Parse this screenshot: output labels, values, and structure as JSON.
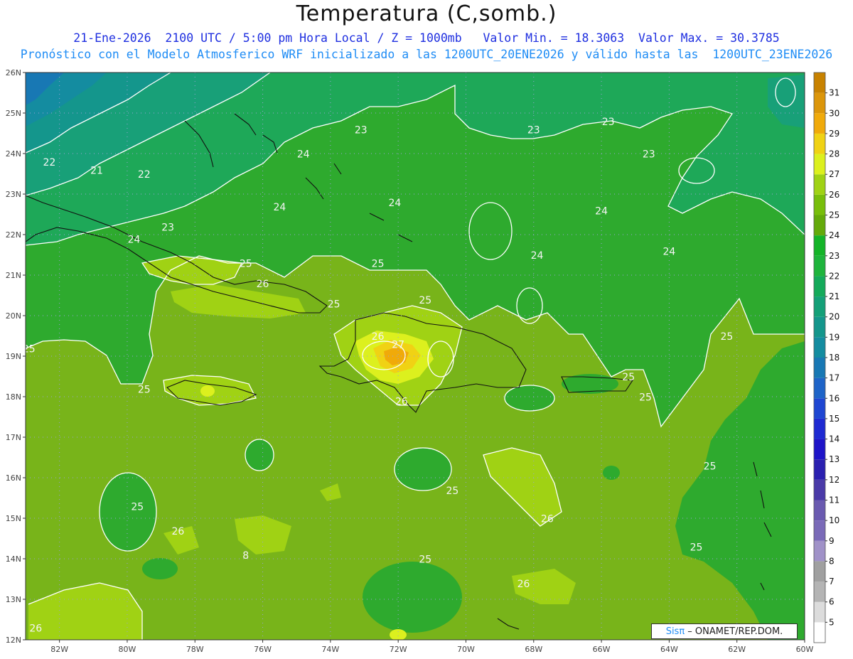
{
  "title": "Temperatura (C,somb.)",
  "subtitle_line1": "21-Ene-2026  2100 UTC / 5:00 pm Hora Local / Z = 1000mb   Valor Min. = 18.3063  Valor Max. = 30.3785",
  "subtitle_line2": "Pronóstico con el Modelo Atmosferico WRF inicializado a las 1200UTC_20ENE2026 y válido hasta las  1200UTC_23ENE2026",
  "credit_brand": "Sisπ",
  "credit_text": " – ONAMET/REP.DOM.",
  "lat_labels": [
    "26N",
    "25N",
    "24N",
    "23N",
    "22N",
    "21N",
    "20N",
    "19N",
    "18N",
    "17N",
    "16N",
    "15N",
    "14N",
    "13N",
    "12N"
  ],
  "lon_labels": [
    "82W",
    "80W",
    "78W",
    "76W",
    "74W",
    "72W",
    "70W",
    "68W",
    "66W",
    "64W",
    "62W",
    "60W"
  ],
  "colorbar": {
    "levels": [
      "5",
      "6",
      "7",
      "8",
      "9",
      "10",
      "11",
      "12",
      "13",
      "14",
      "15",
      "16",
      "17",
      "18",
      "19",
      "20",
      "21",
      "22",
      "23",
      "24",
      "25",
      "26",
      "27",
      "28",
      "29",
      "30",
      "31"
    ],
    "colors": [
      "#ffffff",
      "#dcdcdc",
      "#b4b4b4",
      "#a0a0a0",
      "#a092c8",
      "#7a6ab8",
      "#6a5ab0",
      "#4a3aa8",
      "#2a20b0",
      "#1e14c8",
      "#1e2ad2",
      "#1e46d2",
      "#1e64c8",
      "#1878b4",
      "#148ca0",
      "#14968c",
      "#14a078",
      "#14aa5a",
      "#1eb43c",
      "#14b428",
      "#64aa0a",
      "#78be0a",
      "#a0d214",
      "#dcf01e",
      "#f0d214",
      "#f0aa0a",
      "#dc960a",
      "#c88200"
    ]
  },
  "contour_labels": [
    {
      "t": "22",
      "lon": -82.3,
      "lat": 23.7
    },
    {
      "t": "21",
      "lon": -80.9,
      "lat": 23.5
    },
    {
      "t": "22",
      "lon": -79.5,
      "lat": 23.4
    },
    {
      "t": "24",
      "lon": -74.8,
      "lat": 23.9
    },
    {
      "t": "23",
      "lon": -73.1,
      "lat": 24.5
    },
    {
      "t": "24",
      "lon": -75.5,
      "lat": 22.6
    },
    {
      "t": "24",
      "lon": -72.1,
      "lat": 22.7
    },
    {
      "t": "23",
      "lon": -68.0,
      "lat": 24.5
    },
    {
      "t": "23",
      "lon": -65.8,
      "lat": 24.7
    },
    {
      "t": "23",
      "lon": -64.6,
      "lat": 23.9
    },
    {
      "t": "24",
      "lon": -66.0,
      "lat": 22.5
    },
    {
      "t": "24",
      "lon": -67.9,
      "lat": 21.4
    },
    {
      "t": "24",
      "lon": -64.0,
      "lat": 21.5
    },
    {
      "t": "23",
      "lon": -78.8,
      "lat": 22.1
    },
    {
      "t": "24",
      "lon": -79.8,
      "lat": 21.8
    },
    {
      "t": "25",
      "lon": -76.5,
      "lat": 21.2
    },
    {
      "t": "26",
      "lon": -76.0,
      "lat": 20.7
    },
    {
      "t": "25",
      "lon": -73.9,
      "lat": 20.2
    },
    {
      "t": "25",
      "lon": -72.6,
      "lat": 21.2
    },
    {
      "t": "25",
      "lon": -71.2,
      "lat": 20.3
    },
    {
      "t": "26",
      "lon": -72.6,
      "lat": 19.4
    },
    {
      "t": "27",
      "lon": -72.0,
      "lat": 19.2
    },
    {
      "t": "26",
      "lon": -71.9,
      "lat": 17.8
    },
    {
      "t": "25",
      "lon": -82.9,
      "lat": 19.1
    },
    {
      "t": "25",
      "lon": -79.5,
      "lat": 18.1
    },
    {
      "t": "25",
      "lon": -65.2,
      "lat": 18.4
    },
    {
      "t": "25",
      "lon": -64.7,
      "lat": 17.9
    },
    {
      "t": "25",
      "lon": -62.3,
      "lat": 19.4
    },
    {
      "t": "25",
      "lon": -70.4,
      "lat": 15.6
    },
    {
      "t": "26",
      "lon": -67.6,
      "lat": 14.9
    },
    {
      "t": "25",
      "lon": -62.8,
      "lat": 16.2
    },
    {
      "t": "25",
      "lon": -63.2,
      "lat": 14.2
    },
    {
      "t": "25",
      "lon": -79.7,
      "lat": 15.2
    },
    {
      "t": "26",
      "lon": -78.5,
      "lat": 14.6
    },
    {
      "t": "8",
      "lon": -76.5,
      "lat": 14.0
    },
    {
      "t": "25",
      "lon": -71.2,
      "lat": 13.9
    },
    {
      "t": "26",
      "lon": -68.3,
      "lat": 13.3
    },
    {
      "t": "26",
      "lon": -82.7,
      "lat": 12.2
    }
  ]
}
